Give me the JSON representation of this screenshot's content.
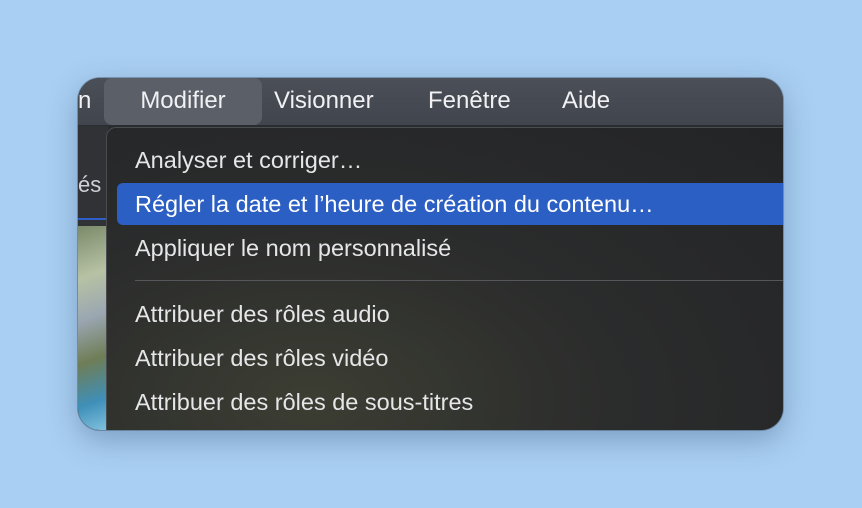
{
  "menubar": {
    "items": [
      {
        "label": "n"
      },
      {
        "label": "Modifier"
      },
      {
        "label": "Visionner"
      },
      {
        "label": "Fenêtre"
      },
      {
        "label": "Aide"
      }
    ]
  },
  "app": {
    "cut_label": "és"
  },
  "menu": {
    "items": [
      {
        "label": "Analyser et corriger…"
      },
      {
        "label": "Régler la date et l’heure de création du contenu…"
      },
      {
        "label": "Appliquer le nom personnalisé"
      },
      {
        "label": "Attribuer des rôles audio"
      },
      {
        "label": "Attribuer des rôles vidéo"
      },
      {
        "label": "Attribuer des rôles de sous-titres"
      }
    ]
  },
  "colors": {
    "desktop": "#a9cff2",
    "highlight": "#2c5fc3",
    "menubar": "#44484f"
  }
}
